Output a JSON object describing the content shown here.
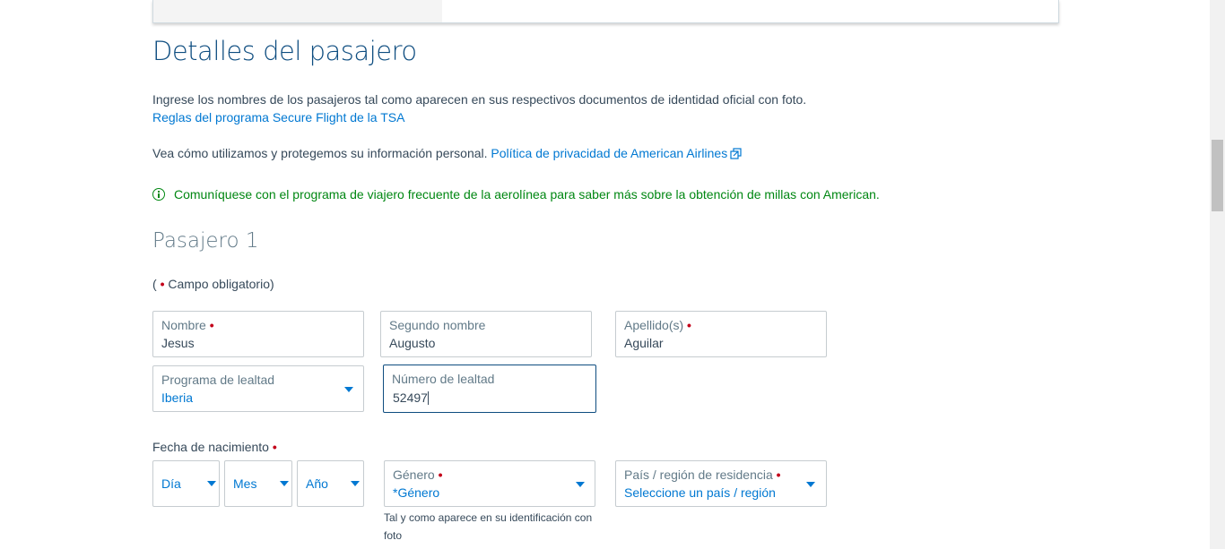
{
  "page": {
    "title": "Detalles del pasajero",
    "instructions": "Ingrese los nombres de los pasajeros tal como aparecen en sus respectivos documentos de identidad oficial con foto.",
    "tsa_link": "Reglas del programa Secure Flight de la TSA",
    "privacy_text": "Vea cómo utilizamos y protegemos su información personal.",
    "privacy_link": "Política de privacidad de American Airlines",
    "info_message": "Comuníquese con el programa de viajero frecuente de la aerolínea para saber más sobre la obtención de millas con American."
  },
  "passenger": {
    "section_title": "Pasajero 1",
    "required_open": "(",
    "required_dot": "•",
    "required_text": "Campo obligatorio)",
    "first_name": {
      "label": "Nombre",
      "value": "Jesus",
      "required": true
    },
    "middle_name": {
      "label": "Segundo nombre",
      "value": "Augusto",
      "required": false
    },
    "last_name": {
      "label": "Apellido(s)",
      "value": "Aguilar",
      "required": true
    },
    "loyalty_program": {
      "label": "Programa de lealtad",
      "value": "Iberia"
    },
    "loyalty_number": {
      "label": "Número de lealtad",
      "value": "52497"
    },
    "dob": {
      "label": "Fecha de nacimiento",
      "day": "Día",
      "month": "Mes",
      "year": "Año"
    },
    "gender": {
      "label": "Género",
      "value": "*Género",
      "helper": "Tal y como aparece en su identificación con foto"
    },
    "country": {
      "label": "País / región de residencia",
      "value": "Seleccione un país / región"
    }
  },
  "colors": {
    "title_blue": "#0e4d80",
    "link_blue": "#0078d2",
    "info_green": "#008712",
    "required_red": "#c30019"
  }
}
